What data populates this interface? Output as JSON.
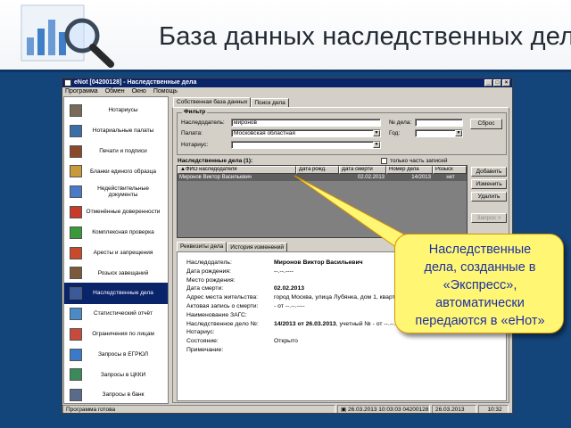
{
  "slide": {
    "title": "База данных наследственных дел"
  },
  "window": {
    "title": "eNot [04200128] - Наследственные дела",
    "menu": [
      "Программа",
      "Обмен",
      "Окно",
      "Помощь"
    ]
  },
  "sidebar": {
    "items": [
      {
        "label": "Нотариусы",
        "icon": "notary-icon",
        "icon_color": "#7a6a5a"
      },
      {
        "label": "Нотариальные палаты",
        "icon": "chamber-building-icon",
        "icon_color": "#3a6ea8"
      },
      {
        "label": "Печати и подписи",
        "icon": "stamp-icon",
        "icon_color": "#8a4a2a"
      },
      {
        "label": "Бланки единого образца",
        "icon": "form-icon",
        "icon_color": "#c89a3a"
      },
      {
        "label": "Недействительные документы",
        "icon": "invalid-document-icon",
        "icon_color": "#4a7ac8"
      },
      {
        "label": "Отменённые доверенности",
        "icon": "cancelled-power-of-attorney-icon",
        "icon_color": "#c83a2a"
      },
      {
        "label": "Комплексная проверка",
        "icon": "complex-check-icon",
        "icon_color": "#3a9a3a"
      },
      {
        "label": "Аресты и запрещения",
        "icon": "arrest-icon",
        "icon_color": "#c84a2a"
      },
      {
        "label": "Розыск завещаний",
        "icon": "will-search-icon",
        "icon_color": "#7a5a3a"
      },
      {
        "label": "Наследственные дела",
        "icon": "inheritance-case-icon",
        "icon_color": "#3a5a9a"
      },
      {
        "label": "Статистический отчёт",
        "icon": "statistics-icon",
        "icon_color": "#4a8ac8"
      },
      {
        "label": "Ограничения по лицам",
        "icon": "person-restriction-icon",
        "icon_color": "#c84a3a"
      },
      {
        "label": "Запросы в ЕГРЮЛ",
        "icon": "egrul-request-icon",
        "icon_color": "#3a7ac8"
      },
      {
        "label": "Запросы в ЦККИ",
        "icon": "tskki-request-icon",
        "icon_color": "#3a8a5a"
      },
      {
        "label": "Запросы в банк",
        "icon": "bank-request-icon",
        "icon_color": "#5a6a8a"
      }
    ],
    "active_index": 9
  },
  "tabs": [
    "Собственная база данных",
    "Поиск дела"
  ],
  "filter": {
    "title": "Фильтр",
    "testator_label": "Наследодатель:",
    "testator_value": "миронов",
    "chamber_label": "Палата:",
    "chamber_value": "Московская областная",
    "notary_label": "Нотариус:",
    "notary_value": "",
    "case_no_label": "№ дела:",
    "case_no_value": "",
    "year_label": "Год:",
    "year_value": "",
    "reset_button": "Сброс"
  },
  "grid": {
    "caption": "Наследственные дела (1):",
    "only_part_label": "только часть записей",
    "columns": [
      "ФИО наследодателя",
      "Дата рожд.",
      "Дата смерти",
      "Номер дела",
      "Розыск"
    ],
    "rows": [
      [
        "Миронов Виктор Васильевич",
        "",
        "02.02.2013",
        "14/2013",
        "нет"
      ]
    ]
  },
  "grid_buttons": {
    "add": "Добавить",
    "edit": "Изменить",
    "delete": "Удалить",
    "request": "Запрос >"
  },
  "detail_tabs": [
    "Реквизиты дела",
    "История изменений"
  ],
  "details": [
    {
      "label": "Наследодатель:",
      "value": "Миронов Виктор Васильевич",
      "bold": true
    },
    {
      "label": "Дата рождения:",
      "value": "--.--.----",
      "bold": false
    },
    {
      "label": "Место рождения:",
      "value": "",
      "bold": false
    },
    {
      "label": "Дата смерти:",
      "value": "02.02.2013",
      "bold": true
    },
    {
      "label": "Адрес места жительства:",
      "value": "город Москва, улица Лубянка, дом 1, кварти",
      "bold": false
    },
    {
      "label": "Актовая запись о смерти:",
      "value": "- от --.--.----",
      "bold": false
    },
    {
      "label": "Наименование ЗАГС:",
      "value": "",
      "bold": false
    },
    {
      "label": "Наследственное дело №:",
      "value": "14/2013 от 26.03.2013",
      "value_rest": ", учетный № - от --.--.----",
      "bold": true
    },
    {
      "label": "Нотариус:",
      "value": "",
      "bold": false
    },
    {
      "label": "Состояние:",
      "value": "Открыто",
      "bold": false
    },
    {
      "label": "Примечание:",
      "value": "",
      "bold": false
    }
  ],
  "statusbar": {
    "status": "Программа готова",
    "session": "26.03.2013 10:03:03 04200128",
    "date": "26.03.2013",
    "time": "10:32"
  },
  "callout": {
    "lines": [
      "Наследственные",
      "дела, созданные в",
      "«Экспресс»,",
      "автоматически",
      "передаются в «еНот»"
    ],
    "bg_color": "#fff774",
    "text_color": "#1d2ea3"
  }
}
